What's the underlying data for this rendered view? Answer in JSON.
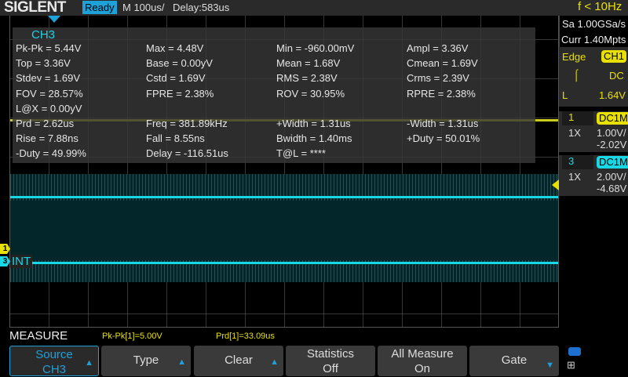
{
  "header": {
    "brand": "SIGLENT",
    "status": "Ready",
    "timebase": "M 100us/",
    "delay": "Delay:583us",
    "trigger_freq": "f < 10Hz"
  },
  "measure_panel": {
    "source": "CH3",
    "rows": [
      [
        "Pk-Pk = 5.44V",
        "Max = 4.48V",
        "Min = -960.00mV",
        "Ampl = 3.36V"
      ],
      [
        "Top = 3.36V",
        "Base = 0.00yV",
        "Mean = 1.68V",
        "Cmean = 1.69V"
      ],
      [
        "Stdev = 1.69V",
        "Cstd = 1.69V",
        "RMS = 2.38V",
        "Crms = 2.39V"
      ],
      [
        "FOV = 28.57%",
        "FPRE = 2.38%",
        "ROV = 30.95%",
        "RPRE = 2.38%"
      ],
      [
        "L@X = 0.00yV",
        "",
        "",
        ""
      ],
      [
        "Prd = 2.62us",
        "Freq = 381.89kHz",
        "+Width = 1.31us",
        "-Width = 1.31us"
      ],
      [
        "Rise = 7.88ns",
        "Fall = 8.55ns",
        "Bwidth = 1.40ms",
        "+Duty = 50.01%"
      ],
      [
        "-Duty = 49.99%",
        "Delay = -116.51us",
        "T@L = ****",
        ""
      ]
    ]
  },
  "markers": {
    "ch1": "1",
    "ch3": "3",
    "int": "INT"
  },
  "side": {
    "sample_rate": "Sa 1.00GSa/s",
    "memory": "Curr 1.40Mpts",
    "trigger": {
      "type": "Edge",
      "source": "CH1",
      "coupling": "DC",
      "level_label": "L",
      "level": "1.64V"
    },
    "ch1": {
      "num": "1",
      "coupling": "DC1M",
      "probe": "1X",
      "scale": "1.00V/",
      "offset": "-2.02V"
    },
    "ch3": {
      "num": "3",
      "coupling": "DC1M",
      "probe": "1X",
      "scale": "2.00V/",
      "offset": "-4.68V"
    }
  },
  "bottom": {
    "title": "MEASURE",
    "meas1": "Pk-Pk[1]=5.00V",
    "meas2": "Prd[1]=33.09us",
    "buttons": [
      {
        "l1": "Source",
        "l2": "CH3"
      },
      {
        "l1": "Type"
      },
      {
        "l1": "Clear"
      },
      {
        "l1": "Statistics",
        "l2": "Off"
      },
      {
        "l1": "All Measure",
        "l2": "On"
      },
      {
        "l1": "Gate"
      }
    ]
  },
  "colors": {
    "ch1": "#e8e000",
    "ch3": "#19d8e6",
    "accent": "#1ea0d8"
  }
}
